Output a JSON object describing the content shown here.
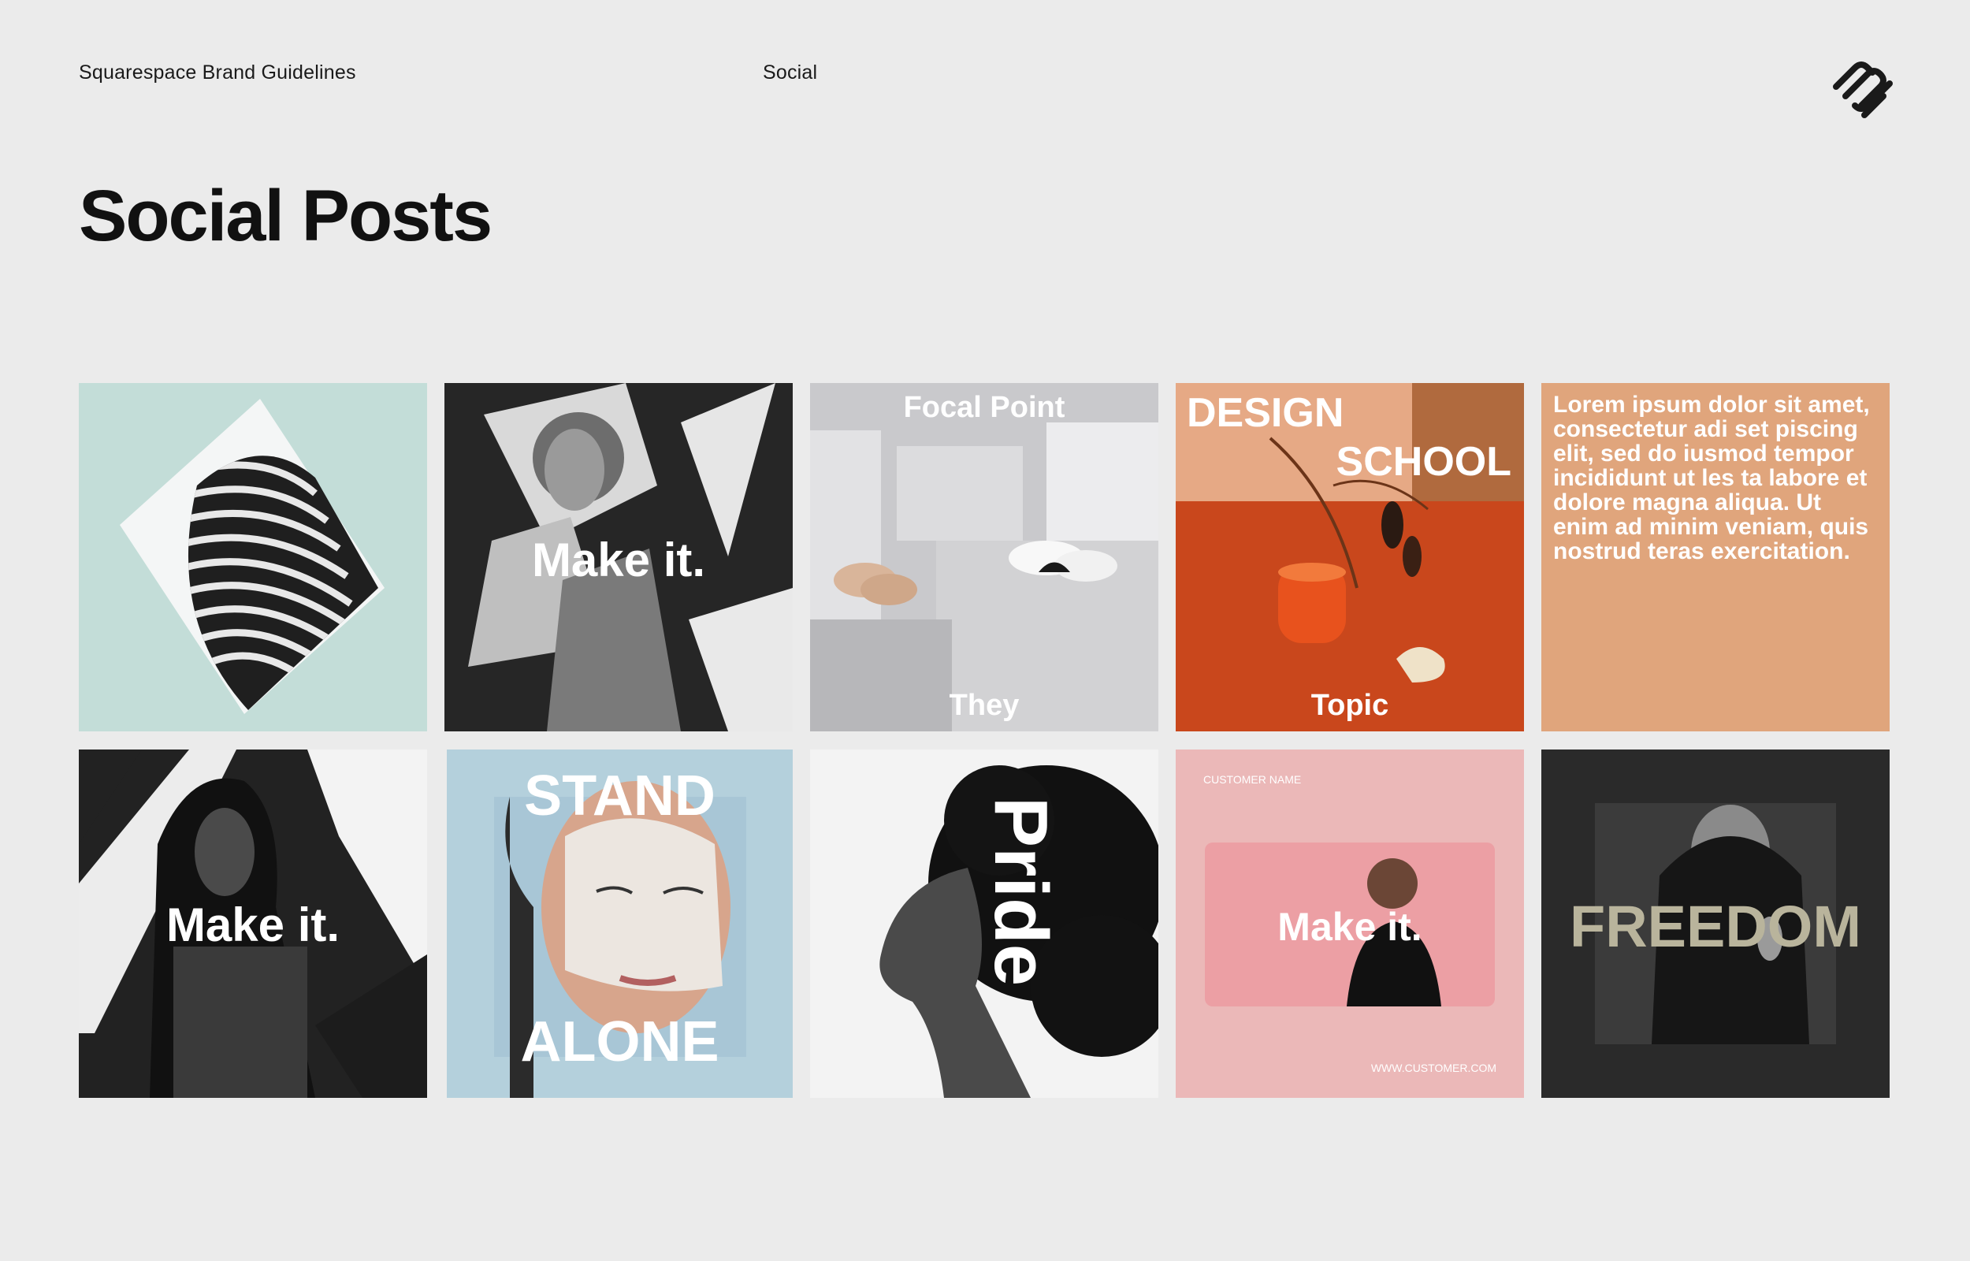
{
  "header": {
    "brand": "Squarespace Brand Guidelines",
    "section": "Social",
    "logo_icon": "squarespace-logo-icon"
  },
  "page": {
    "title": "Social Posts"
  },
  "posts": [
    {
      "id": "architecture",
      "bg": "#c3ddd8"
    },
    {
      "id": "make-it-woman",
      "bg": "#262626",
      "text": "Make it."
    },
    {
      "id": "focal-point",
      "bg": "#c9c9cc",
      "top_text": "Focal Point",
      "bottom_text": "They"
    },
    {
      "id": "design-school",
      "bg": "#c7461b",
      "line1": "DESIGN",
      "line2": "SCHOOL",
      "bottom_text": "Topic"
    },
    {
      "id": "lorem",
      "bg": "#e0a57c",
      "text": "Lorem ipsum dolor sit amet, consectetur adi set piscing elit, sed do iusmod tempor incididunt ut les ta labore et dolore magna aliqua. Ut enim ad minim veniam, quis nostrud teras exercitation."
    },
    {
      "id": "make-it-man",
      "bg": "#222222",
      "text": "Make it."
    },
    {
      "id": "stand-alone",
      "bg": "#b4d0dc",
      "top_text": "STAND",
      "bottom_text": "ALONE"
    },
    {
      "id": "pride",
      "bg": "#f3f3f3",
      "text": "Pride"
    },
    {
      "id": "customer",
      "bg": "#ebb8b8",
      "customer_name": "CUSTOMER NAME",
      "text": "Make it.",
      "url": "WWW.CUSTOMER.COM"
    },
    {
      "id": "freedom",
      "bg": "#2a2a2a",
      "text": "FREEDOM"
    }
  ]
}
